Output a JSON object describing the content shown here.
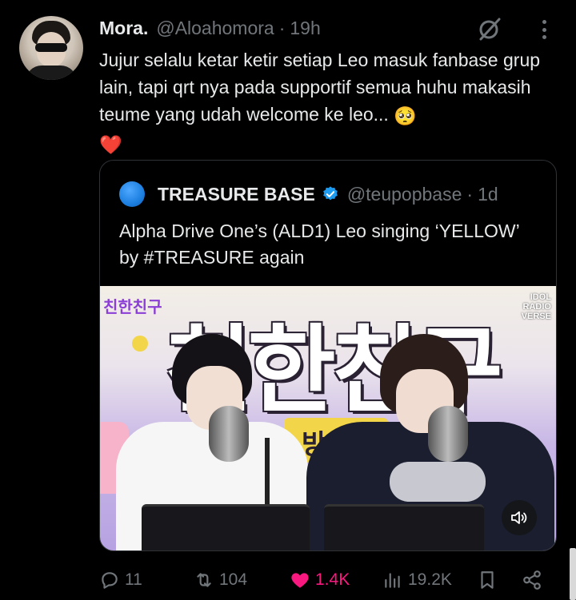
{
  "post": {
    "display_name": "Mora.",
    "handle": "@Aloahomora",
    "separator": "·",
    "time": "19h",
    "text": "Jujur selalu ketar ketir setiap Leo masuk fanbase grup lain, tapi qrt nya pada supportif semua huhu makasih teume yang udah welcome ke leo...",
    "emoji_1": "🥺",
    "emoji_2": "❤️"
  },
  "quote": {
    "display_name": "TREASURE BASE",
    "handle": "@teupopbase",
    "separator": "·",
    "time": "1d",
    "text": "Alpha Drive One’s (ALD1) Leo singing ‘YELLOW’ by #TREASURE again",
    "media": {
      "banner_text": "친한친구",
      "corner_logo": "친한친구",
      "radio_logo_line1": "IDOL",
      "radio_logo_line2": "RADIO",
      "radio_logo_line3": "VERSE",
      "sign_text": "방"
    }
  },
  "actions": {
    "replies": "11",
    "retweets": "104",
    "likes": "1.4K",
    "views": "19.2K"
  },
  "colors": {
    "background": "#000000",
    "text": "#e7e9ea",
    "muted": "#71767b",
    "like": "#f91880",
    "verified": "#1d9bf0"
  },
  "icons": [
    "grok-icon",
    "more-icon",
    "verified-icon",
    "sound-icon",
    "reply-icon",
    "retweet-icon",
    "like-icon",
    "views-icon",
    "bookmark-icon",
    "share-icon"
  ]
}
